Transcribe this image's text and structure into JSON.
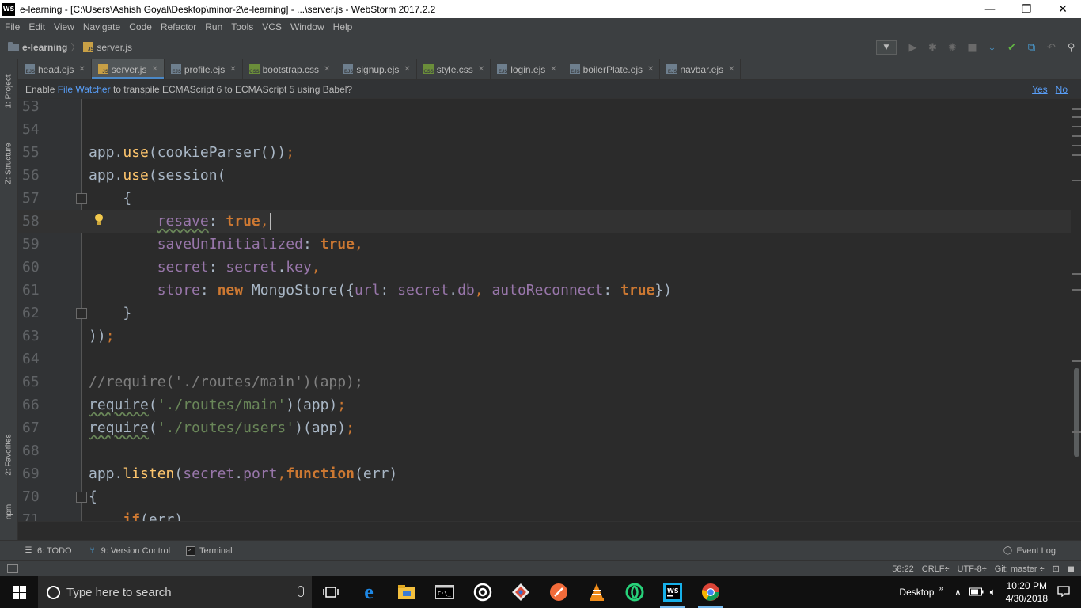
{
  "window": {
    "title": "e-learning - [C:\\Users\\Ashish Goyal\\Desktop\\minor-2\\e-learning] - ...\\server.js - WebStorm 2017.2.2",
    "app_icon_text": "WS",
    "controls": {
      "minimize": "—",
      "maximize": "❐",
      "close": "✕"
    }
  },
  "menu": {
    "items": [
      "File",
      "Edit",
      "View",
      "Navigate",
      "Code",
      "Refactor",
      "Run",
      "Tools",
      "VCS",
      "Window",
      "Help"
    ]
  },
  "breadcrumb": {
    "project": "e-learning",
    "separator": "〉",
    "file": "server.js",
    "file_icon": "JS"
  },
  "tool_strip": {
    "project": "1: Project",
    "structure": "Z: Structure",
    "favorites": "2: Favorites",
    "npm": "npm"
  },
  "tabs": [
    {
      "label": "head.ejs",
      "icon": "EJS",
      "type": "ejs",
      "close": "✕"
    },
    {
      "label": "server.js",
      "icon": "JS",
      "type": "js",
      "close": "✕",
      "active": true
    },
    {
      "label": "profile.ejs",
      "icon": "EJS",
      "type": "ejs",
      "close": "✕"
    },
    {
      "label": "bootstrap.css",
      "icon": "CSS",
      "type": "css",
      "close": "✕"
    },
    {
      "label": "signup.ejs",
      "icon": "EJS",
      "type": "ejs",
      "close": "✕"
    },
    {
      "label": "style.css",
      "icon": "CSS",
      "type": "css",
      "close": "✕"
    },
    {
      "label": "login.ejs",
      "icon": "EJS",
      "type": "ejs",
      "close": "✕"
    },
    {
      "label": "boilerPlate.ejs",
      "icon": "EJS",
      "type": "ejs",
      "close": "✕"
    },
    {
      "label": "navbar.ejs",
      "icon": "EJS",
      "type": "ejs",
      "close": "✕"
    }
  ],
  "banner": {
    "prefix": "Enable ",
    "link": "File Watcher",
    "suffix": " to transpile ECMAScript 6 to ECMAScript 5 using Babel?",
    "yes": "Yes",
    "no": "No"
  },
  "editor": {
    "lines": [
      {
        "num": "53",
        "tokens": []
      },
      {
        "num": "54",
        "tokens": []
      },
      {
        "num": "55",
        "tokens": [
          [
            "",
            "app."
          ],
          [
            "f",
            "use"
          ],
          [
            "",
            "(cookieParser())"
          ],
          [
            "semi",
            ";"
          ]
        ]
      },
      {
        "num": "56",
        "tokens": [
          [
            "",
            "app."
          ],
          [
            "f",
            "use"
          ],
          [
            "",
            "(session("
          ]
        ],
        "fold": false
      },
      {
        "num": "57",
        "tokens": [
          [
            "",
            "    {"
          ]
        ],
        "fold": true
      },
      {
        "num": "58",
        "tokens": [
          [
            "",
            "        "
          ],
          [
            "p uw",
            "resave"
          ],
          [
            "",
            ": "
          ],
          [
            "k",
            "true"
          ],
          [
            "semi",
            ","
          ]
        ],
        "current": true,
        "bulb": true,
        "caret": true
      },
      {
        "num": "59",
        "tokens": [
          [
            "",
            "        "
          ],
          [
            "p",
            "saveUnInitialized"
          ],
          [
            "",
            ": "
          ],
          [
            "k",
            "true"
          ],
          [
            "semi",
            ","
          ]
        ]
      },
      {
        "num": "60",
        "tokens": [
          [
            "",
            "        "
          ],
          [
            "p",
            "secret"
          ],
          [
            "",
            ": "
          ],
          [
            "p",
            "secret"
          ],
          [
            "",
            "."
          ],
          [
            "p",
            "key"
          ],
          [
            "semi",
            ","
          ]
        ]
      },
      {
        "num": "61",
        "tokens": [
          [
            "",
            "        "
          ],
          [
            "p",
            "store"
          ],
          [
            "",
            ": "
          ],
          [
            "k",
            "new"
          ],
          [
            "",
            " MongoStore({"
          ],
          [
            "p",
            "url"
          ],
          [
            "",
            ": "
          ],
          [
            "p",
            "secret"
          ],
          [
            "",
            "."
          ],
          [
            "p",
            "db"
          ],
          [
            "semi",
            ","
          ],
          [
            "",
            " "
          ],
          [
            "p",
            "autoReconnect"
          ],
          [
            "",
            ": "
          ],
          [
            "k",
            "true"
          ],
          [
            "",
            "})"
          ]
        ]
      },
      {
        "num": "62",
        "tokens": [
          [
            "",
            "    }"
          ]
        ],
        "fold": true
      },
      {
        "num": "63",
        "tokens": [
          [
            "",
            "))"
          ],
          [
            "semi",
            ";"
          ]
        ]
      },
      {
        "num": "64",
        "tokens": []
      },
      {
        "num": "65",
        "tokens": [
          [
            "c",
            "//require('./routes/main')(app);"
          ]
        ]
      },
      {
        "num": "66",
        "tokens": [
          [
            "uw",
            "require"
          ],
          [
            "",
            "("
          ],
          [
            "s",
            "'./routes/main'"
          ],
          [
            "",
            ")(app)"
          ],
          [
            "semi",
            ";"
          ]
        ]
      },
      {
        "num": "67",
        "tokens": [
          [
            "uw",
            "require"
          ],
          [
            "",
            "("
          ],
          [
            "s",
            "'./routes/users'"
          ],
          [
            "",
            ")(app)"
          ],
          [
            "semi",
            ";"
          ]
        ]
      },
      {
        "num": "68",
        "tokens": []
      },
      {
        "num": "69",
        "tokens": [
          [
            "",
            "app."
          ],
          [
            "f",
            "listen"
          ],
          [
            "",
            "("
          ],
          [
            "p",
            "secret"
          ],
          [
            "",
            "."
          ],
          [
            "p",
            "port"
          ],
          [
            "semi",
            ","
          ],
          [
            "k",
            "function"
          ],
          [
            "",
            "(err)"
          ]
        ]
      },
      {
        "num": "70",
        "tokens": [
          [
            "",
            "{"
          ]
        ],
        "fold": true
      },
      {
        "num": "71",
        "tokens": [
          [
            "",
            "    "
          ],
          [
            "k",
            "if"
          ],
          [
            "",
            "(err)"
          ]
        ]
      }
    ]
  },
  "bottom_tools": {
    "todo": "6: TODO",
    "vcs": "9: Version Control",
    "terminal": "Terminal",
    "event_log": "Event Log"
  },
  "status": {
    "position": "58:22",
    "line_sep": "CRLF÷",
    "encoding": "UTF-8÷",
    "git": "Git: master ÷"
  },
  "taskbar": {
    "search_placeholder": "Type here to search",
    "desktop": "Desktop",
    "time": "10:20 PM",
    "date": "4/30/2018"
  }
}
